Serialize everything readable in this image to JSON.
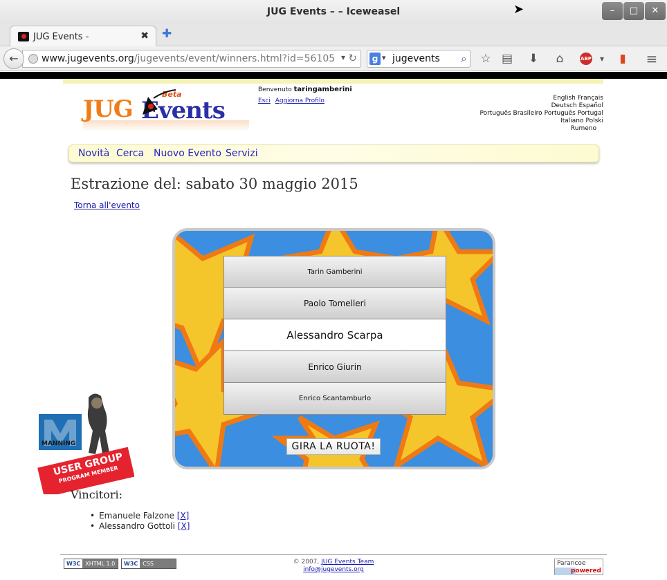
{
  "browser": {
    "window_title": "JUG Events – – Iceweasel",
    "tab_title": "JUG Events -",
    "url_host": "www.jugevents.org",
    "url_path": "/jugevents/event/winners.html?id=56105",
    "search_value": "jugevents",
    "search_engine_icon": "google-icon"
  },
  "header": {
    "logo_jug": "JUG",
    "logo_events": "Events",
    "logo_beta": "Beta",
    "welcome_prefix": "Benvenuto",
    "username": "taringamberini",
    "logout_link": "Esci",
    "profile_link": "Aggiorna Profilo",
    "languages": [
      [
        "English",
        "Français"
      ],
      [
        "Deutsch",
        "Español"
      ],
      [
        "Português Brasileiro",
        "Português Portugal"
      ],
      [
        "Italiano",
        "Polski"
      ],
      [
        "Rumeno"
      ]
    ]
  },
  "menu": {
    "items": [
      "Novità",
      "Cerca",
      "Nuovo Evento",
      "Servizi"
    ]
  },
  "main": {
    "heading": "Estrazione del: sabato 30 maggio 2015",
    "back_link": "Torna all'evento",
    "wheel_names": [
      "Tarin Gamberini",
      "Paolo Tomelleri",
      "Alessandro Scarpa",
      "Enrico Giurin",
      "Enrico Scantamburlo"
    ],
    "selected_index": 2,
    "spin_button": "GIRA LA RUOTA!",
    "badge": {
      "brand": "MANNING",
      "line1": "USER GROUP",
      "line2": "PROGRAM MEMBER"
    },
    "winners_title": "Vincitori:",
    "winners": [
      {
        "name": "Emanuele Falzone",
        "remove": "[X]"
      },
      {
        "name": "Alessandro Gottoli",
        "remove": "[X]"
      }
    ]
  },
  "footer": {
    "xhtml_badge": [
      "W3C",
      "XHTML 1.0"
    ],
    "css_badge": [
      "W3C",
      "CSS"
    ],
    "copyright": "© 2007,",
    "team_link": "JUG Events Team",
    "email_link": "info@jugevents.org",
    "parancoe_top": "Parancoe",
    "parancoe_bottom": "powered"
  },
  "colors": {
    "link": "#1a1ab0",
    "menu_link": "#2424c8",
    "wheel_bg": "#3c8ee0",
    "star_fill": "#f5c52c",
    "star_border": "#ef7a14",
    "menubar_bg": "#fdfbd0"
  }
}
